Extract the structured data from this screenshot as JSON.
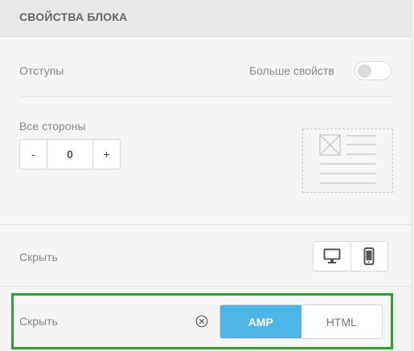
{
  "header": {
    "title": "СВОЙСТВА БЛОКА"
  },
  "padding_row": {
    "label": "Отступы",
    "more_label": "Больше свойств",
    "toggle_on": false
  },
  "sides": {
    "label": "Все стороны",
    "minus_label": "-",
    "value": "0",
    "plus_label": "+"
  },
  "hide_devices": {
    "label": "Скрыть",
    "icons": [
      "desktop-icon",
      "mobile-icon"
    ]
  },
  "hide_format": {
    "label": "Скрыть",
    "clear_icon": "clear-icon",
    "options": [
      "AMP",
      "HTML"
    ],
    "selected": "AMP"
  },
  "colors": {
    "accent": "#4db5e8",
    "highlight": "#2aa52a"
  }
}
